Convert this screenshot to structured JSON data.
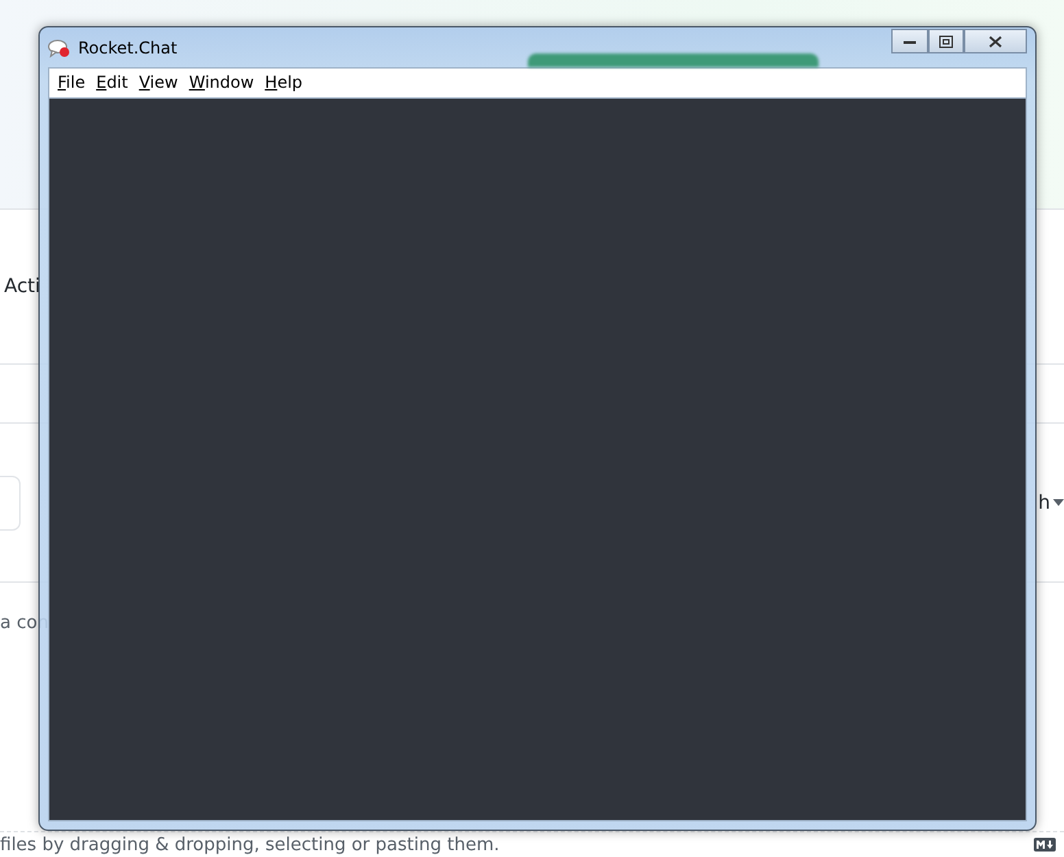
{
  "background_page": {
    "section_label": "Acti",
    "caption": "a con",
    "dropdown_label": "h",
    "drop_hint": "files by dragging & dropping, selecting or pasting them."
  },
  "window": {
    "title": "Rocket.Chat",
    "menu": [
      {
        "label": "File"
      },
      {
        "label": "Edit"
      },
      {
        "label": "View"
      },
      {
        "label": "Window"
      },
      {
        "label": "Help"
      }
    ]
  }
}
